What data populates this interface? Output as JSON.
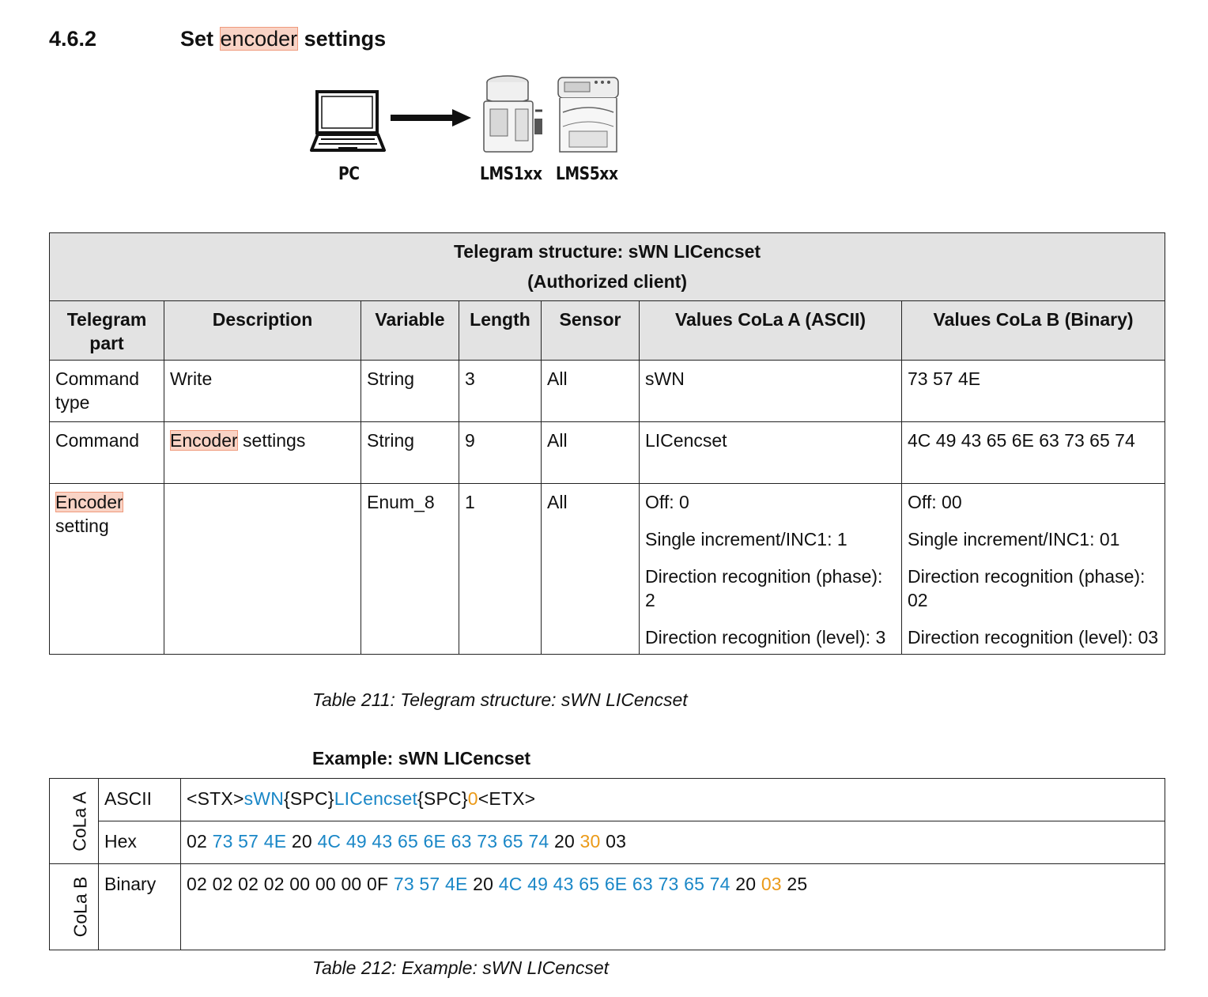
{
  "section": {
    "number": "4.6.2",
    "title_pre": "Set ",
    "title_highlight": "encoder",
    "title_post": " settings"
  },
  "diagram": {
    "pc_label": "PC",
    "sensor1_label": "LMS1xx",
    "sensor2_label": "LMS5xx"
  },
  "colors": {
    "highlight_fill": "#f9d3c5",
    "highlight_border": "#ef9a7c",
    "header_fill": "#e3e3e3",
    "blue": "#1a87c7",
    "orange": "#eb9a18"
  },
  "table1": {
    "title_line1": "Telegram structure: sWN LICencset",
    "title_line2": "(Authorized client)",
    "headers": [
      "Telegram part",
      "Description",
      "Variable",
      "Length",
      "Sensor",
      "Values CoLa A (ASCII)",
      "Values CoLa B (Binary)"
    ],
    "row1": {
      "part": "Command type",
      "description": "Write",
      "variable": "String",
      "length": "3",
      "sensor": "All",
      "cola_a": "sWN",
      "cola_b": "73 57 4E"
    },
    "row2": {
      "part": "Command",
      "description_highlight": "Encoder",
      "description_rest": " settings",
      "variable": "String",
      "length": "9",
      "sensor": "All",
      "cola_a": "LICencset",
      "cola_b": "4C 49 43 65 6E 63 73 65 74"
    },
    "row3": {
      "part_highlight": "Encoder",
      "part_rest": "setting",
      "description": "",
      "variable": "Enum_8",
      "length": "1",
      "sensor": "All",
      "cola_a": [
        "Off: 0",
        "Single increment/INC1: 1",
        "Direction recognition (phase): 2",
        "Direction recognition (level): 3"
      ],
      "cola_b": [
        "Off: 00",
        "Single increment/INC1: 01",
        "Direction recognition (phase): 02",
        "Direction recognition (level): 03"
      ]
    },
    "caption": "Table 211: Telegram structure: sWN LICencset"
  },
  "example": {
    "title": "Example: sWN LICencset",
    "cola_a_label": "CoLa A",
    "cola_b_label": "CoLa B",
    "ascii": {
      "label": "ASCII",
      "p1": "<STX>",
      "p2": "sWN",
      "p3": "{SPC}",
      "p4": "LICencset",
      "p5": "{SPC}",
      "p6": "0",
      "p7": "<ETX>"
    },
    "hex": {
      "label": "Hex",
      "p1": "02 ",
      "p2": "73 57 4E",
      "p3": " 20 ",
      "p4": "4C 49 43 65 6E 63 73 65 74",
      "p5": " 20 ",
      "p6": "30",
      "p7": " 03"
    },
    "binary": {
      "label": "Binary",
      "p1": "02 02 02 02 00 00 00 0F ",
      "p2": "73 57 4E",
      "p3": " 20 ",
      "p4": "4C 49 43 65 6E 63 73 65 74",
      "p5": " 20 ",
      "p6": "03",
      "p7": " 25"
    },
    "caption": "Table 212: Example: sWN LICencset"
  }
}
